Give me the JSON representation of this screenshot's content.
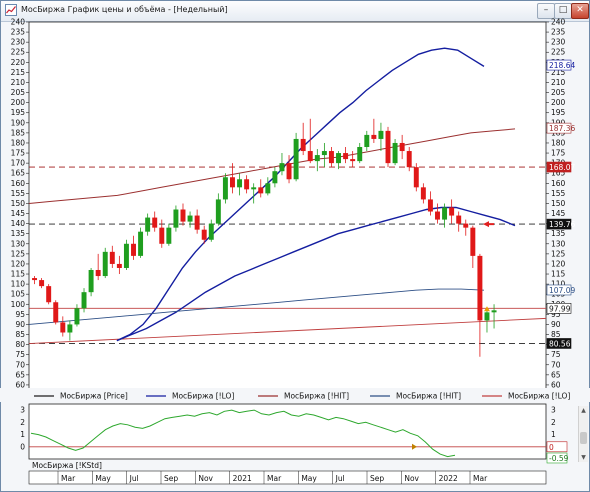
{
  "window": {
    "title": "МосБиржа График цены и объёма - [Недельный]",
    "minimize_label": "–",
    "maximize_label": "□",
    "close_label": "✕"
  },
  "colors": {
    "price_line": "#1e1e1e",
    "up_candle": "#1f9e1f",
    "down_candle": "#e01818",
    "lo_band": "#141ea0",
    "hit_band": "#9b3030",
    "hit_line": "#c04040",
    "lo_line": "#2d4f86",
    "dashed": "#a01818",
    "oscillator": "#2ea82e",
    "bg": "#ffffff"
  },
  "legend": [
    {
      "label": "МосБиржа [Price]",
      "color": "#1e1e1e"
    },
    {
      "label": "МосБиржа [!LO]",
      "color": "#141ea0"
    },
    {
      "label": "МосБиржа [!HIT]",
      "color": "#9b3030"
    },
    {
      "label": "МосБиржа [!HIT]",
      "color": "#2d4f86"
    },
    {
      "label": "МосБиржа [!LO]",
      "color": "#c04040"
    }
  ],
  "oscillator_label": "МосБиржа [!KStd]",
  "chart_data": [
    {
      "type": "line",
      "ylim": [
        55,
        240
      ],
      "y_ticks": [
        60,
        65,
        70,
        75,
        80,
        85,
        90,
        95,
        100,
        105,
        110,
        115,
        120,
        125,
        130,
        135,
        140,
        145,
        150,
        155,
        160,
        165,
        170,
        175,
        180,
        185,
        190,
        195,
        200,
        205,
        210,
        215,
        220,
        225,
        230,
        235,
        240
      ],
      "x_ticks": [
        "Mar",
        "May",
        "Jul",
        "Sep",
        "Nov",
        "2021",
        "Mar",
        "May",
        "Jul",
        "Sep",
        "Nov",
        "2022",
        "Mar"
      ],
      "price_ohlc": [
        [
          113,
          114,
          110,
          112
        ],
        [
          112,
          113,
          108,
          109
        ],
        [
          109,
          110,
          100,
          101
        ],
        [
          101,
          102,
          90,
          91
        ],
        [
          91,
          94,
          84,
          86
        ],
        [
          86,
          92,
          82,
          90
        ],
        [
          90,
          100,
          89,
          98
        ],
        [
          98,
          108,
          96,
          106
        ],
        [
          106,
          118,
          104,
          117
        ],
        [
          117,
          125,
          112,
          114
        ],
        [
          114,
          128,
          113,
          126
        ],
        [
          126,
          129,
          118,
          120
        ],
        [
          120,
          124,
          115,
          118
        ],
        [
          118,
          132,
          117,
          130
        ],
        [
          130,
          134,
          122,
          124
        ],
        [
          124,
          138,
          123,
          136
        ],
        [
          136,
          145,
          134,
          143
        ],
        [
          143,
          146,
          136,
          138
        ],
        [
          138,
          142,
          128,
          130
        ],
        [
          130,
          140,
          129,
          138
        ],
        [
          138,
          149,
          136,
          147
        ],
        [
          147,
          150,
          139,
          141
        ],
        [
          141,
          146,
          138,
          144
        ],
        [
          144,
          147,
          135,
          137
        ],
        [
          137,
          139,
          130,
          132
        ],
        [
          132,
          142,
          131,
          140
        ],
        [
          140,
          155,
          139,
          152
        ],
        [
          152,
          165,
          150,
          163
        ],
        [
          163,
          170,
          155,
          158
        ],
        [
          158,
          165,
          154,
          162
        ],
        [
          162,
          164,
          155,
          157
        ],
        [
          157,
          160,
          150,
          158
        ],
        [
          158,
          162,
          153,
          155
        ],
        [
          155,
          163,
          154,
          160
        ],
        [
          160,
          168,
          158,
          166
        ],
        [
          166,
          175,
          164,
          170
        ],
        [
          170,
          174,
          160,
          162
        ],
        [
          162,
          185,
          161,
          182
        ],
        [
          182,
          190,
          174,
          176
        ],
        [
          176,
          192,
          170,
          171
        ],
        [
          171,
          177,
          166,
          174
        ],
        [
          174,
          180,
          168,
          176
        ],
        [
          176,
          178,
          168,
          170
        ],
        [
          170,
          176,
          167,
          175
        ],
        [
          175,
          178,
          170,
          172
        ],
        [
          172,
          176,
          168,
          171
        ],
        [
          171,
          180,
          170,
          178
        ],
        [
          178,
          186,
          176,
          184
        ],
        [
          184,
          192,
          180,
          182
        ],
        [
          182,
          190,
          176,
          186
        ],
        [
          186,
          188,
          168,
          170
        ],
        [
          170,
          182,
          169,
          180
        ],
        [
          180,
          184,
          172,
          176
        ],
        [
          176,
          178,
          166,
          168
        ],
        [
          168,
          170,
          156,
          158
        ],
        [
          158,
          160,
          150,
          152
        ],
        [
          152,
          156,
          144,
          146
        ],
        [
          146,
          150,
          140,
          142
        ],
        [
          142,
          150,
          138,
          148
        ],
        [
          148,
          152,
          140,
          144
        ],
        [
          144,
          146,
          136,
          140
        ],
        [
          140,
          142,
          134,
          138
        ],
        [
          138,
          139,
          118,
          124
        ],
        [
          124,
          125,
          74,
          92
        ],
        [
          92,
          97,
          86,
          96
        ],
        [
          96,
          100,
          88,
          97
        ]
      ],
      "series": [
        {
          "name": "МосБиржа [!LO]",
          "values": [
            82,
            85,
            90,
            98,
            108,
            118,
            126,
            133,
            139,
            145,
            151,
            157,
            163,
            170,
            177,
            183,
            189,
            195,
            200,
            206,
            211,
            216,
            220,
            224,
            226,
            227,
            226,
            222,
            218
          ]
        },
        {
          "name": "МосБиржа [!HIT]",
          "values": [
            150,
            151,
            152,
            153,
            154,
            156,
            158,
            160,
            162,
            164,
            166,
            168,
            170,
            172,
            173,
            175,
            177,
            179,
            181,
            183,
            185,
            186,
            187
          ]
        },
        {
          "name": "МосБиржа [!HIT]",
          "values": [
            82,
            85,
            88,
            92,
            96,
            101,
            106,
            110,
            114,
            117,
            120,
            123,
            126,
            129,
            132,
            135,
            137,
            139,
            141,
            143,
            145,
            147,
            148,
            148,
            146,
            144,
            142,
            139
          ]
        },
        {
          "name": "МосБиржа [!LO]",
          "values": [
            90,
            91,
            92,
            93,
            94,
            95,
            96,
            97,
            98,
            99,
            100,
            101,
            102,
            103,
            104,
            105,
            106,
            107,
            107.5,
            107.5,
            107
          ]
        }
      ],
      "horizontal_levels": [
        168.07,
        139.76,
        97.99,
        80.56
      ],
      "value_labels": [
        "218.64",
        "187.36",
        "168.07",
        "139.76",
        "107.09",
        "97.99",
        "80.56"
      ]
    },
    {
      "type": "line",
      "name": "МосБиржа [!KStd]",
      "ylim": [
        -1,
        3.5
      ],
      "y_ticks": [
        0,
        1,
        2,
        3
      ],
      "values": [
        1.1,
        1.0,
        0.8,
        0.5,
        0.2,
        -0.1,
        -0.3,
        -0.1,
        0.4,
        0.9,
        1.4,
        1.7,
        1.9,
        1.8,
        1.6,
        1.5,
        1.7,
        2.0,
        2.3,
        2.4,
        2.5,
        2.6,
        2.5,
        2.7,
        2.8,
        2.6,
        2.9,
        3.0,
        2.8,
        2.9,
        3.0,
        2.7,
        2.6,
        2.8,
        2.9,
        2.6,
        2.5,
        2.7,
        2.6,
        2.4,
        2.2,
        2.4,
        2.3,
        2.1,
        1.9,
        2.0,
        1.8,
        1.6,
        1.4,
        1.2,
        1.4,
        1.1,
        0.9,
        0.4,
        -0.2,
        -0.6,
        -0.8,
        -0.7
      ],
      "value_labels": [
        "0",
        "-0.59"
      ]
    }
  ]
}
